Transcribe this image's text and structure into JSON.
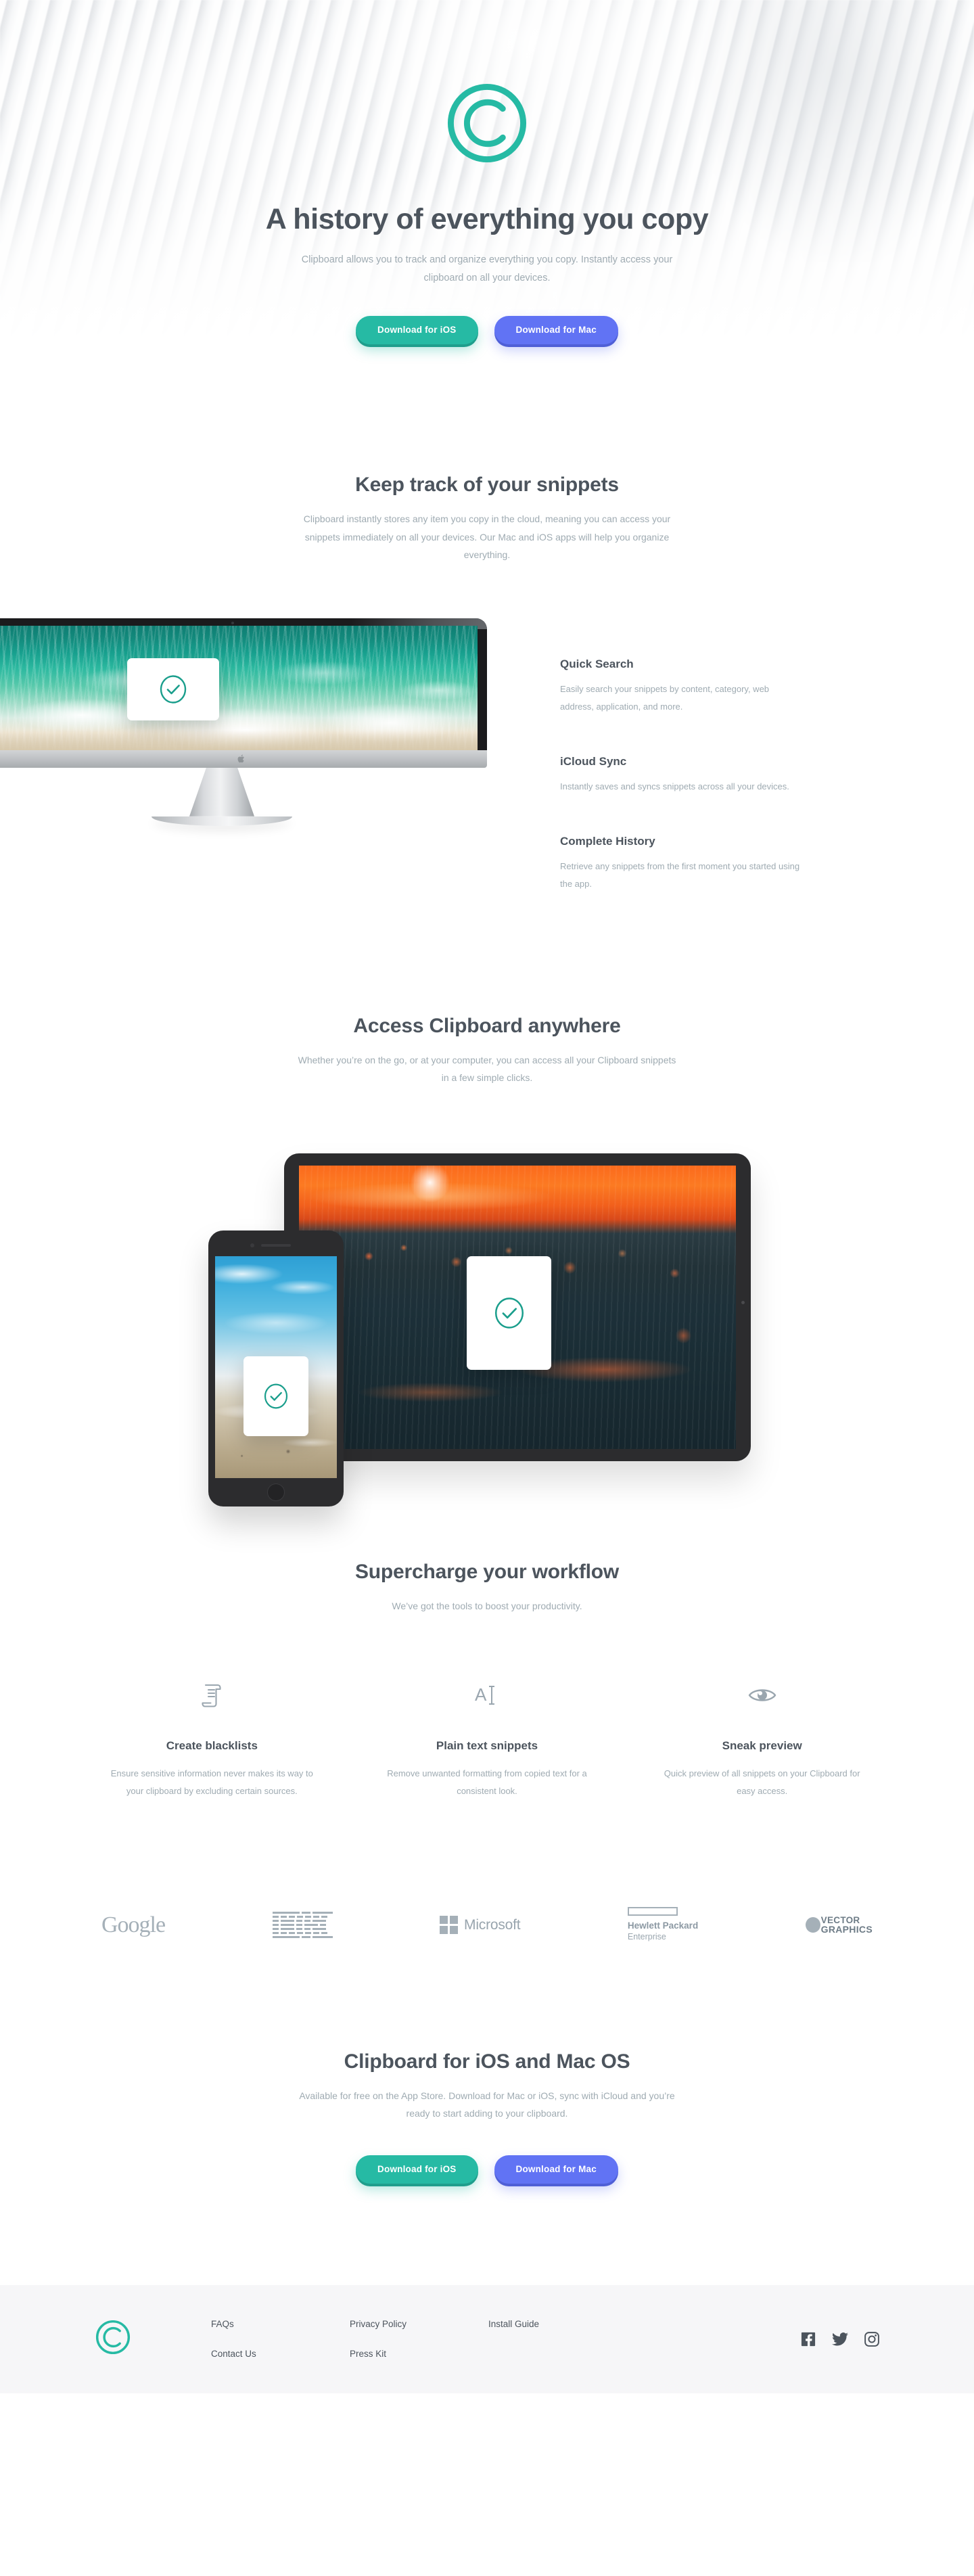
{
  "brand": {
    "name": "Clipboard",
    "logo_icon": "clipboard-c-logo-icon"
  },
  "colors": {
    "accent_teal": "#26baa4",
    "accent_blue": "#6173f4",
    "heading": "#4c545d",
    "body_text": "#9fabb2",
    "footer_bg": "#f6f6f8",
    "logo_gray": "#a5b0b8"
  },
  "hero": {
    "title": "A history of everything you copy",
    "subtitle": "Clipboard allows you to track and organize everything you copy. Instantly access your clipboard on all your devices.",
    "buttons": [
      {
        "label": "Download for iOS",
        "style": "teal"
      },
      {
        "label": "Download for Mac",
        "style": "blue"
      }
    ]
  },
  "snippets": {
    "title": "Keep track of your snippets",
    "subtitle": "Clipboard instantly stores any item you copy in the cloud, meaning you can access your snippets immediately on all your devices. Our Mac and iOS apps will help you organize everything.",
    "features": [
      {
        "title": "Quick Search",
        "text": "Easily search your snippets by content, category, web address, application, and more."
      },
      {
        "title": "iCloud Sync",
        "text": "Instantly saves and syncs snippets across all your devices."
      },
      {
        "title": "Complete History",
        "text": "Retrieve any snippets from the first moment you started using the app."
      }
    ],
    "device_image": "imac-ocean-wallpaper-with-check-popup"
  },
  "access": {
    "title": "Access Clipboard anywhere",
    "subtitle": "Whether you’re on the go, or at your computer, you can access all your Clipboard snippets in a few simple clicks.",
    "device_image": "iphone-and-ipad-with-check-popups"
  },
  "supercharge": {
    "title": "Supercharge your workflow",
    "subtitle": "We’ve got the tools to boost your productivity.",
    "tools": [
      {
        "icon": "blacklist-scroll-icon",
        "title": "Create blacklists",
        "text": "Ensure sensitive information never makes its way to your clipboard by excluding certain sources."
      },
      {
        "icon": "plain-text-icon",
        "title": "Plain text snippets",
        "text": "Remove unwanted formatting from copied text for a consistent look."
      },
      {
        "icon": "eye-preview-icon",
        "title": "Sneak preview",
        "text": "Quick preview of all snippets on your Clipboard for easy access."
      }
    ]
  },
  "logos": [
    {
      "name": "Google",
      "icon": "google-logo"
    },
    {
      "name": "IBM",
      "icon": "ibm-logo"
    },
    {
      "name": "Microsoft",
      "icon": "microsoft-logo"
    },
    {
      "name": "Hewlett Packard Enterprise",
      "line1": "Hewlett Packard",
      "line2": "Enterprise",
      "icon": "hp-enterprise-logo"
    },
    {
      "name": "Vector Graphics",
      "line1": "VECTOR",
      "line2": "GRAPHICS",
      "icon": "vector-graphics-logo"
    }
  ],
  "cta": {
    "title": "Clipboard for iOS and Mac OS",
    "subtitle": "Available for free on the App Store. Download for Mac or iOS, sync with iCloud and you’re ready to start adding to your clipboard.",
    "buttons": [
      {
        "label": "Download for iOS",
        "style": "teal"
      },
      {
        "label": "Download for Mac",
        "style": "blue"
      }
    ]
  },
  "footer": {
    "logo_icon": "clipboard-c-logo-icon",
    "links": [
      {
        "label": "FAQs"
      },
      {
        "label": "Contact Us"
      },
      {
        "label": "Privacy Policy"
      },
      {
        "label": "Press Kit"
      },
      {
        "label": "Install Guide"
      }
    ],
    "socials": [
      {
        "name": "facebook-icon"
      },
      {
        "name": "twitter-icon"
      },
      {
        "name": "instagram-icon"
      }
    ]
  }
}
